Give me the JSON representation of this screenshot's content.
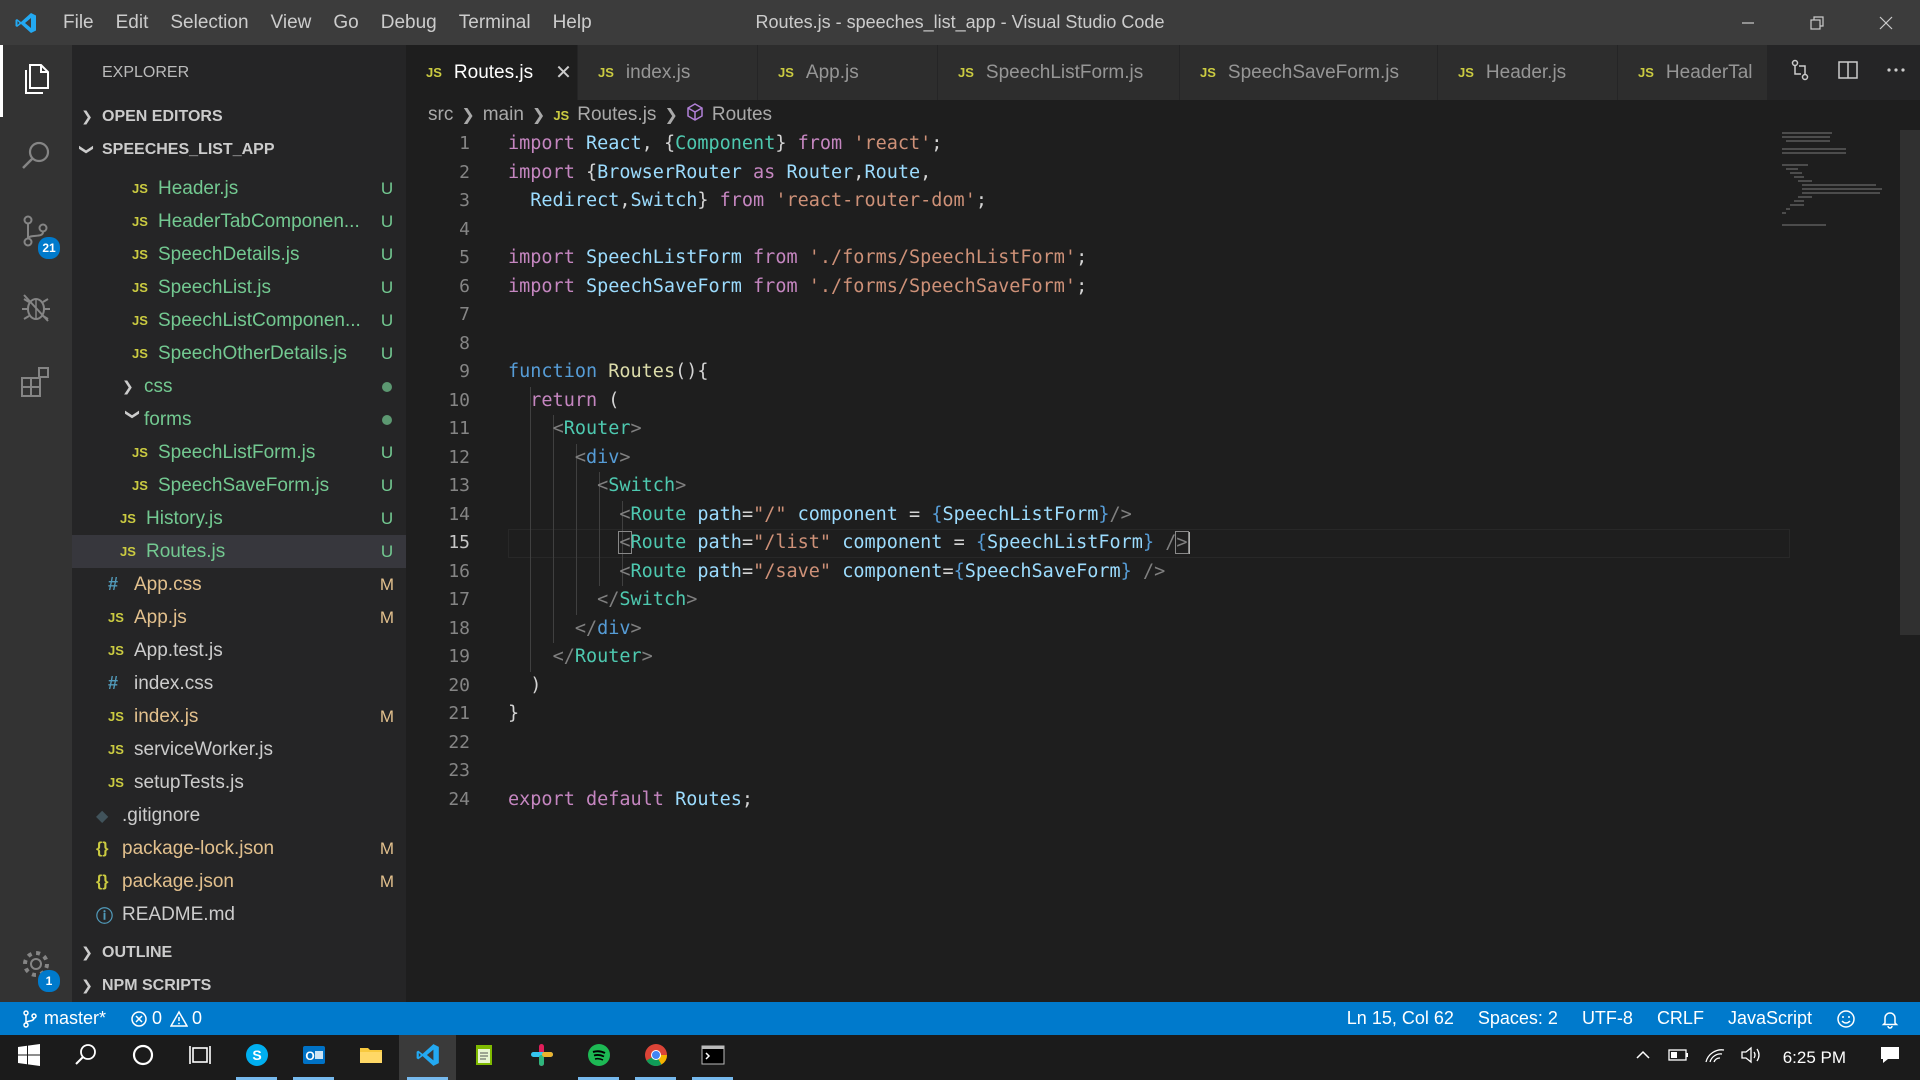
{
  "titlebar": {
    "menu": [
      "File",
      "Edit",
      "Selection",
      "View",
      "Go",
      "Debug",
      "Terminal",
      "Help"
    ],
    "title": "Routes.js - speeches_list_app - Visual Studio Code"
  },
  "activity": {
    "scm_badge": "21",
    "settings_badge": "1"
  },
  "sidebar": {
    "title": "EXPLORER",
    "open_editors": "OPEN EDITORS",
    "project": "SPEECHES_LIST_APP",
    "outline": "OUTLINE",
    "npm_scripts": "NPM SCRIPTS",
    "files": [
      {
        "label": "Header.js",
        "status": "U"
      },
      {
        "label": "HeaderTabComponen...",
        "status": "U"
      },
      {
        "label": "SpeechDetails.js",
        "status": "U"
      },
      {
        "label": "SpeechList.js",
        "status": "U"
      },
      {
        "label": "SpeechListComponen...",
        "status": "U"
      },
      {
        "label": "SpeechOtherDetails.js",
        "status": "U"
      },
      {
        "label": "css",
        "status": ""
      },
      {
        "label": "forms",
        "status": ""
      },
      {
        "label": "SpeechListForm.js",
        "status": "U"
      },
      {
        "label": "SpeechSaveForm.js",
        "status": "U"
      },
      {
        "label": "History.js",
        "status": "U"
      },
      {
        "label": "Routes.js",
        "status": "U"
      },
      {
        "label": "App.css",
        "status": "M"
      },
      {
        "label": "App.js",
        "status": "M"
      },
      {
        "label": "App.test.js",
        "status": ""
      },
      {
        "label": "index.css",
        "status": ""
      },
      {
        "label": "index.js",
        "status": "M"
      },
      {
        "label": "serviceWorker.js",
        "status": ""
      },
      {
        "label": "setupTests.js",
        "status": ""
      },
      {
        "label": ".gitignore",
        "status": ""
      },
      {
        "label": "package-lock.json",
        "status": "M"
      },
      {
        "label": "package.json",
        "status": "M"
      },
      {
        "label": "README.md",
        "status": ""
      }
    ]
  },
  "tabs": [
    "Routes.js",
    "index.js",
    "App.js",
    "SpeechListForm.js",
    "SpeechSaveForm.js",
    "Header.js",
    "HeaderTal"
  ],
  "tab_icon": "JS",
  "breadcrumb": {
    "a": "src",
    "b": "main",
    "c": "Routes.js",
    "d": "Routes"
  },
  "editor": {
    "line_numbers": [
      "1",
      "2",
      "3",
      "4",
      "5",
      "6",
      "7",
      "8",
      "9",
      "10",
      "11",
      "12",
      "13",
      "14",
      "15",
      "16",
      "17",
      "18",
      "19",
      "20",
      "21",
      "22",
      "23",
      "24"
    ]
  },
  "statusbar": {
    "branch": "master*",
    "errors": "0",
    "warnings": "0",
    "position": "Ln 15, Col 62",
    "spaces": "Spaces: 2",
    "encoding": "UTF-8",
    "eol": "CRLF",
    "language": "JavaScript"
  },
  "taskbar": {
    "clock": "6:25 PM"
  },
  "colors": {
    "accent": "#007acc",
    "titlebar": "#3c3c3c",
    "sidebar": "#252526",
    "editor": "#1e1e1e"
  }
}
